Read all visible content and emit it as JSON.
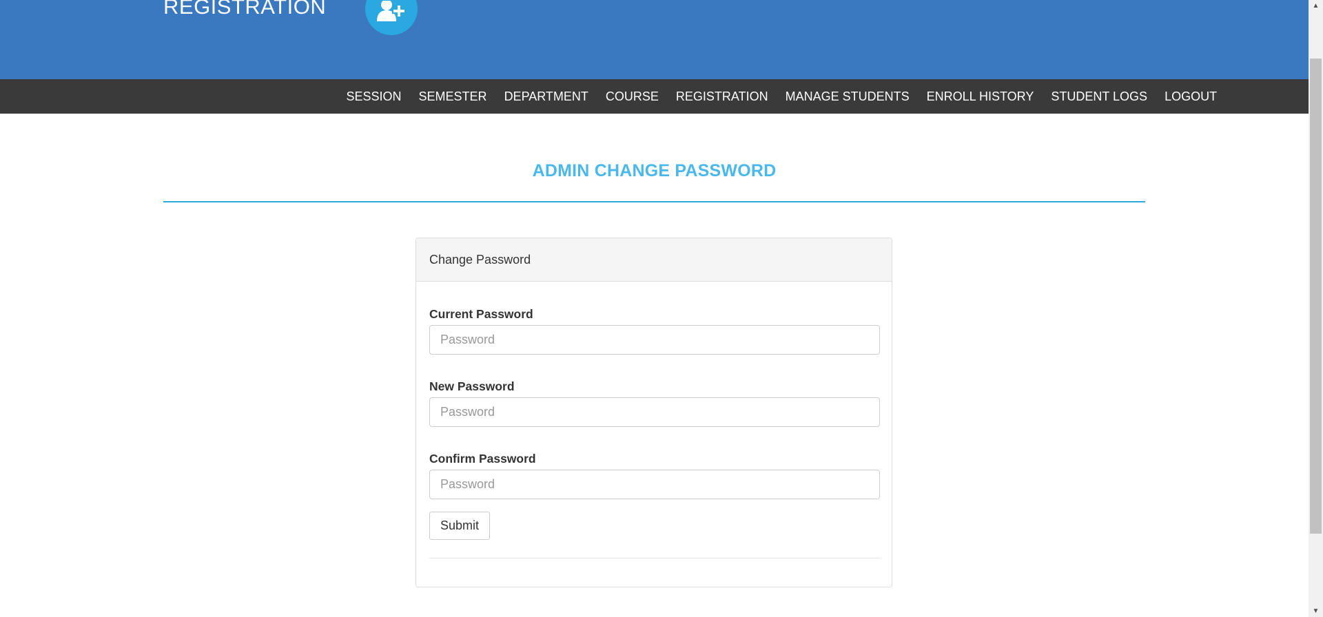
{
  "header": {
    "brand_text": "REGISTRATION",
    "logo_icon": "user-plus-icon",
    "background_color": "#3a79bf",
    "logo_color": "#29a9df"
  },
  "nav": {
    "background_color": "#3a3a3a",
    "items": [
      {
        "label": "SESSION"
      },
      {
        "label": "SEMESTER"
      },
      {
        "label": "DEPARTMENT"
      },
      {
        "label": "COURSE"
      },
      {
        "label": "REGISTRATION"
      },
      {
        "label": "MANAGE STUDENTS"
      },
      {
        "label": "ENROLL HISTORY"
      },
      {
        "label": "STUDENT LOGS"
      },
      {
        "label": "LOGOUT"
      }
    ]
  },
  "page": {
    "title": "ADMIN CHANGE PASSWORD",
    "title_color": "#4bb8ec"
  },
  "panel": {
    "heading": "Change Password",
    "fields": [
      {
        "label": "Current Password",
        "placeholder": "Password",
        "value": ""
      },
      {
        "label": "New Password",
        "placeholder": "Password",
        "value": ""
      },
      {
        "label": "Confirm Password",
        "placeholder": "Password",
        "value": ""
      }
    ],
    "submit_label": "Submit"
  },
  "scrollbar": {
    "up_icon": "scroll-up-arrow-icon",
    "down_icon": "scroll-down-arrow-icon"
  }
}
